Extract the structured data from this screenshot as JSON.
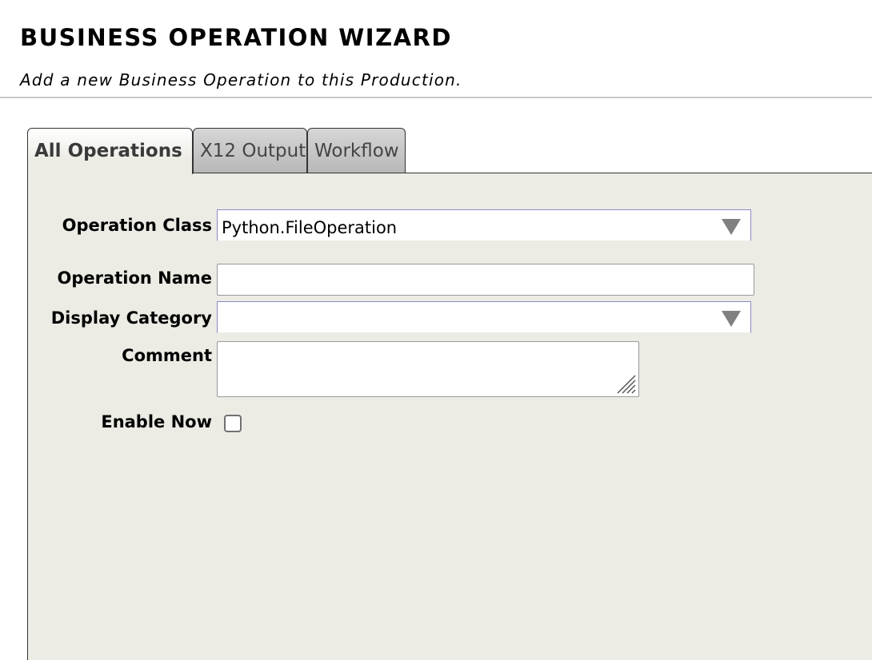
{
  "header": {
    "title": "BUSINESS OPERATION WIZARD",
    "subtitle": "Add a new Business Operation to this Production."
  },
  "tabs": [
    {
      "label": "All Operations",
      "active": true
    },
    {
      "label": "X12 Output",
      "active": false
    },
    {
      "label": "Workflow",
      "active": false
    }
  ],
  "form": {
    "operation_class": {
      "label": "Operation Class",
      "value": "Python.FileOperation"
    },
    "operation_name": {
      "label": "Operation Name",
      "value": ""
    },
    "display_category": {
      "label": "Display Category",
      "value": ""
    },
    "comment": {
      "label": "Comment",
      "value": ""
    },
    "enable_now": {
      "label": "Enable Now",
      "checked": false
    }
  },
  "colors": {
    "panel_bg": "#ecebe4",
    "select_border": "#8c8cc8",
    "arrow": "#808080"
  }
}
